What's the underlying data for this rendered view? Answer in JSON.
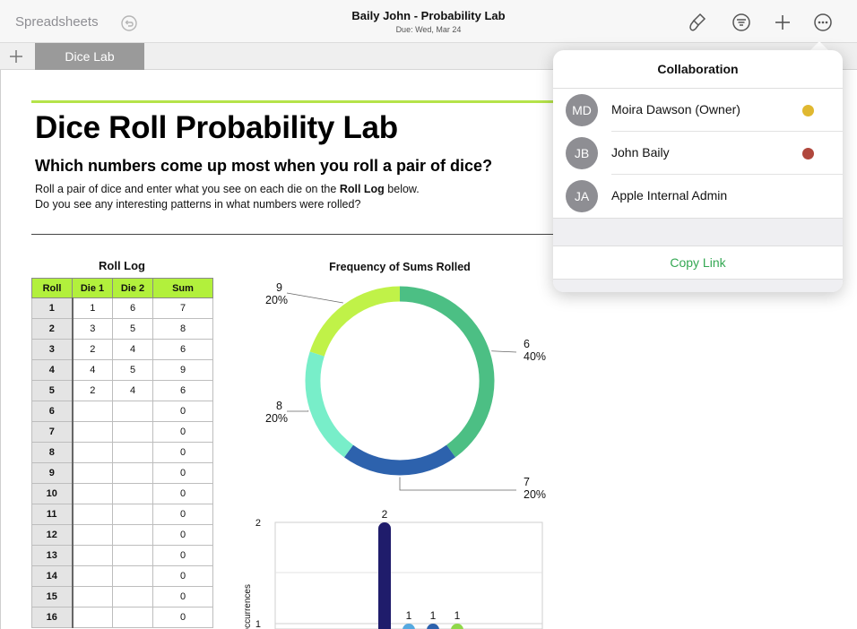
{
  "toolbar": {
    "back_label": "Spreadsheets",
    "doc_title": "Baily John - Probability Lab",
    "doc_due": "Due: Wed, Mar 24",
    "icons": [
      "undo-icon",
      "format-brush-icon",
      "filter-icon",
      "add-icon",
      "more-icon"
    ]
  },
  "tabs": [
    {
      "label": "Dice Lab"
    }
  ],
  "lab": {
    "title": "Dice Roll Probability Lab",
    "subtitle": "Which numbers come up most when you roll a pair of dice?",
    "instr1_pre": "Roll a pair of dice and enter what you see on each die on the ",
    "instr1_bold": "Roll Log",
    "instr1_post": " below.",
    "instr2": "Do you see any interesting patterns in what numbers were rolled?"
  },
  "roll_log": {
    "title": "Roll Log",
    "headers": [
      "Roll",
      "Die 1",
      "Die 2",
      "Sum"
    ],
    "rows": [
      [
        "1",
        "1",
        "6",
        "7"
      ],
      [
        "2",
        "3",
        "5",
        "8"
      ],
      [
        "3",
        "2",
        "4",
        "6"
      ],
      [
        "4",
        "4",
        "5",
        "9"
      ],
      [
        "5",
        "2",
        "4",
        "6"
      ],
      [
        "6",
        "",
        "",
        "0"
      ],
      [
        "7",
        "",
        "",
        "0"
      ],
      [
        "8",
        "",
        "",
        "0"
      ],
      [
        "9",
        "",
        "",
        "0"
      ],
      [
        "10",
        "",
        "",
        "0"
      ],
      [
        "11",
        "",
        "",
        "0"
      ],
      [
        "12",
        "",
        "",
        "0"
      ],
      [
        "13",
        "",
        "",
        "0"
      ],
      [
        "14",
        "",
        "",
        "0"
      ],
      [
        "15",
        "",
        "",
        "0"
      ],
      [
        "16",
        "",
        "",
        "0"
      ]
    ]
  },
  "chart_data": [
    {
      "type": "pie",
      "title": "Frequency of Sums Rolled",
      "slices": [
        {
          "label": "6",
          "value": 40,
          "pct_label": "40%",
          "color": "#4cbf84"
        },
        {
          "label": "7",
          "value": 20,
          "pct_label": "20%",
          "color": "#2d62ad"
        },
        {
          "label": "8",
          "value": 20,
          "pct_label": "20%",
          "color": "#78eec9"
        },
        {
          "label": "9",
          "value": 20,
          "pct_label": "20%",
          "color": "#c0f248"
        }
      ]
    },
    {
      "type": "bar",
      "title": "",
      "ylabel": "Occurrences",
      "y_ticks": [
        "2",
        "1"
      ],
      "ylim": [
        0,
        2
      ],
      "values": [
        2,
        1,
        1,
        1
      ],
      "data_labels": [
        "2",
        "1",
        "1",
        "1"
      ],
      "colors": [
        "#1f1c6b",
        "#56a9e0",
        "#2d62ad",
        "#8fd84a"
      ]
    }
  ],
  "collaboration": {
    "title": "Collaboration",
    "people": [
      {
        "initials": "MD",
        "name": "Moira Dawson (Owner)",
        "color": "#e0b830"
      },
      {
        "initials": "JB",
        "name": "John Baily",
        "color": "#b0473c"
      },
      {
        "initials": "JA",
        "name": "Apple Internal Admin",
        "color": ""
      }
    ],
    "copy_link": "Copy Link"
  }
}
